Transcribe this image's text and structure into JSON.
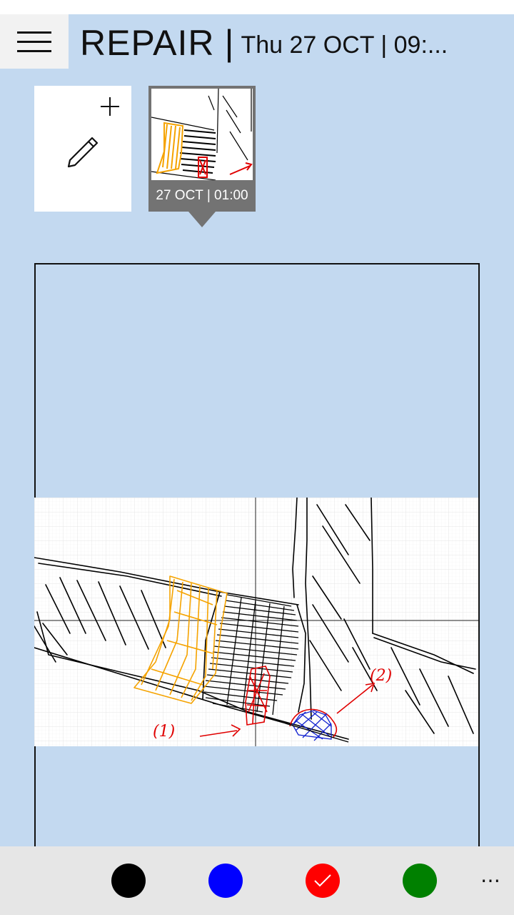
{
  "header": {
    "menu_icon": "hamburger-icon",
    "title": "REPAIR",
    "separator": "|",
    "subtitle": "Thu 27 OCT | 09:..."
  },
  "notes": {
    "new_note": {
      "icons": [
        "plus-icon",
        "pencil-icon"
      ]
    },
    "thumbnails": [
      {
        "label": "27 OCT | 01:00",
        "selected": true
      }
    ]
  },
  "sketch": {
    "annotations": [
      "(1)",
      "(2)"
    ],
    "colors": {
      "orange": "#f5a300",
      "red": "#e00000",
      "blue": "#1020d0",
      "black": "#000000"
    }
  },
  "palette": {
    "colors": [
      {
        "name": "black",
        "hex": "#000000",
        "selected": false
      },
      {
        "name": "blue",
        "hex": "#0000ff",
        "selected": false
      },
      {
        "name": "red",
        "hex": "#ff0000",
        "selected": true
      },
      {
        "name": "green",
        "hex": "#008000",
        "selected": false
      }
    ],
    "more_label": "⋯"
  }
}
